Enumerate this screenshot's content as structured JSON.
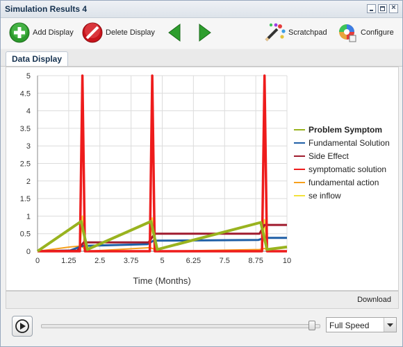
{
  "window": {
    "title": "Simulation Results 4"
  },
  "toolbar": {
    "add_label": "Add Display",
    "delete_label": "Delete Display",
    "scratchpad_label": "Scratchpad",
    "configure_label": "Configure"
  },
  "tabs": [
    {
      "label": "Data Display"
    }
  ],
  "download_label": "Download",
  "speed": {
    "selected": "Full Speed"
  },
  "playback": {
    "position_fraction": 1.0
  },
  "chart_data": {
    "type": "line",
    "xlabel": "Time (Months)",
    "ylabel": "",
    "xlim": [
      0,
      10
    ],
    "ylim": [
      0,
      5
    ],
    "x_ticks": [
      "0",
      "1.25",
      "2.5",
      "3.75",
      "5",
      "6.25",
      "7.5",
      "8.75",
      "10"
    ],
    "y_ticks": [
      "0",
      "0.5",
      "1",
      "1.5",
      "2",
      "2.5",
      "3",
      "3.5",
      "4",
      "4.5",
      "5"
    ],
    "grid": true,
    "legend_position": "right",
    "series": [
      {
        "name": "Problem Symptom",
        "color": "#99b31f",
        "bold": true,
        "points": [
          [
            0,
            0
          ],
          [
            1.75,
            0.85
          ],
          [
            2.0,
            0.05
          ],
          [
            4.55,
            0.85
          ],
          [
            4.8,
            0.05
          ],
          [
            8.95,
            0.82
          ],
          [
            9.2,
            0.05
          ],
          [
            10,
            0.12
          ]
        ]
      },
      {
        "name": "Fundamental Solution",
        "color": "#1f5fa6",
        "points": [
          [
            0,
            0
          ],
          [
            1.3,
            0.02
          ],
          [
            1.8,
            0.15
          ],
          [
            4.4,
            0.2
          ],
          [
            4.65,
            0.3
          ],
          [
            8.85,
            0.32
          ],
          [
            9.1,
            0.38
          ],
          [
            10,
            0.38
          ]
        ]
      },
      {
        "name": "Side Effect",
        "color": "#a01b2e",
        "points": [
          [
            0,
            0
          ],
          [
            1.6,
            0.02
          ],
          [
            1.85,
            0.25
          ],
          [
            4.45,
            0.25
          ],
          [
            4.7,
            0.5
          ],
          [
            8.9,
            0.5
          ],
          [
            9.1,
            0.75
          ],
          [
            10,
            0.75
          ]
        ]
      },
      {
        "name": "symptomatic solution",
        "color": "#ee1c1c",
        "points": [
          [
            0,
            0
          ],
          [
            1.7,
            0
          ],
          [
            1.8,
            5
          ],
          [
            1.9,
            0
          ],
          [
            4.5,
            0
          ],
          [
            4.6,
            5
          ],
          [
            4.7,
            0
          ],
          [
            9.0,
            0
          ],
          [
            9.1,
            5
          ],
          [
            9.2,
            0
          ],
          [
            10,
            0
          ]
        ]
      },
      {
        "name": "fundamental action",
        "color": "#f7a01c",
        "points": [
          [
            0,
            0
          ],
          [
            1.3,
            0.12
          ],
          [
            1.75,
            0.15
          ],
          [
            2.0,
            0.0
          ],
          [
            4.5,
            0.1
          ],
          [
            4.75,
            0.05
          ],
          [
            5.0,
            0.0
          ],
          [
            8.9,
            0.05
          ],
          [
            9.1,
            0.08
          ],
          [
            9.3,
            0.0
          ],
          [
            10,
            0.0
          ]
        ]
      },
      {
        "name": "se inflow",
        "color": "#f2e23a",
        "points": [
          [
            0,
            0
          ],
          [
            1.7,
            0
          ],
          [
            1.8,
            1.0
          ],
          [
            1.9,
            0
          ],
          [
            4.5,
            0
          ],
          [
            4.6,
            0.95
          ],
          [
            4.7,
            0
          ],
          [
            9.0,
            0
          ],
          [
            9.1,
            0.9
          ],
          [
            9.2,
            0
          ],
          [
            10,
            0
          ]
        ]
      }
    ]
  }
}
